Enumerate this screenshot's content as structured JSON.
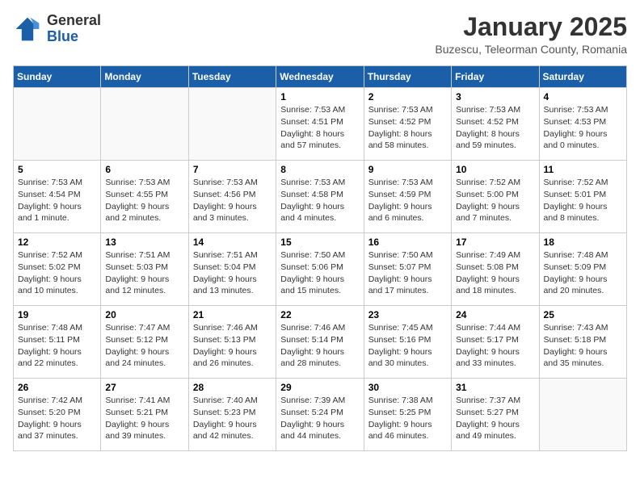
{
  "header": {
    "logo_line1": "General",
    "logo_line2": "Blue",
    "month": "January 2025",
    "location": "Buzescu, Teleorman County, Romania"
  },
  "weekdays": [
    "Sunday",
    "Monday",
    "Tuesday",
    "Wednesday",
    "Thursday",
    "Friday",
    "Saturday"
  ],
  "weeks": [
    [
      {
        "day": "",
        "info": ""
      },
      {
        "day": "",
        "info": ""
      },
      {
        "day": "",
        "info": ""
      },
      {
        "day": "1",
        "info": "Sunrise: 7:53 AM\nSunset: 4:51 PM\nDaylight: 8 hours and 57 minutes."
      },
      {
        "day": "2",
        "info": "Sunrise: 7:53 AM\nSunset: 4:52 PM\nDaylight: 8 hours and 58 minutes."
      },
      {
        "day": "3",
        "info": "Sunrise: 7:53 AM\nSunset: 4:52 PM\nDaylight: 8 hours and 59 minutes."
      },
      {
        "day": "4",
        "info": "Sunrise: 7:53 AM\nSunset: 4:53 PM\nDaylight: 9 hours and 0 minutes."
      }
    ],
    [
      {
        "day": "5",
        "info": "Sunrise: 7:53 AM\nSunset: 4:54 PM\nDaylight: 9 hours and 1 minute."
      },
      {
        "day": "6",
        "info": "Sunrise: 7:53 AM\nSunset: 4:55 PM\nDaylight: 9 hours and 2 minutes."
      },
      {
        "day": "7",
        "info": "Sunrise: 7:53 AM\nSunset: 4:56 PM\nDaylight: 9 hours and 3 minutes."
      },
      {
        "day": "8",
        "info": "Sunrise: 7:53 AM\nSunset: 4:58 PM\nDaylight: 9 hours and 4 minutes."
      },
      {
        "day": "9",
        "info": "Sunrise: 7:53 AM\nSunset: 4:59 PM\nDaylight: 9 hours and 6 minutes."
      },
      {
        "day": "10",
        "info": "Sunrise: 7:52 AM\nSunset: 5:00 PM\nDaylight: 9 hours and 7 minutes."
      },
      {
        "day": "11",
        "info": "Sunrise: 7:52 AM\nSunset: 5:01 PM\nDaylight: 9 hours and 8 minutes."
      }
    ],
    [
      {
        "day": "12",
        "info": "Sunrise: 7:52 AM\nSunset: 5:02 PM\nDaylight: 9 hours and 10 minutes."
      },
      {
        "day": "13",
        "info": "Sunrise: 7:51 AM\nSunset: 5:03 PM\nDaylight: 9 hours and 12 minutes."
      },
      {
        "day": "14",
        "info": "Sunrise: 7:51 AM\nSunset: 5:04 PM\nDaylight: 9 hours and 13 minutes."
      },
      {
        "day": "15",
        "info": "Sunrise: 7:50 AM\nSunset: 5:06 PM\nDaylight: 9 hours and 15 minutes."
      },
      {
        "day": "16",
        "info": "Sunrise: 7:50 AM\nSunset: 5:07 PM\nDaylight: 9 hours and 17 minutes."
      },
      {
        "day": "17",
        "info": "Sunrise: 7:49 AM\nSunset: 5:08 PM\nDaylight: 9 hours and 18 minutes."
      },
      {
        "day": "18",
        "info": "Sunrise: 7:48 AM\nSunset: 5:09 PM\nDaylight: 9 hours and 20 minutes."
      }
    ],
    [
      {
        "day": "19",
        "info": "Sunrise: 7:48 AM\nSunset: 5:11 PM\nDaylight: 9 hours and 22 minutes."
      },
      {
        "day": "20",
        "info": "Sunrise: 7:47 AM\nSunset: 5:12 PM\nDaylight: 9 hours and 24 minutes."
      },
      {
        "day": "21",
        "info": "Sunrise: 7:46 AM\nSunset: 5:13 PM\nDaylight: 9 hours and 26 minutes."
      },
      {
        "day": "22",
        "info": "Sunrise: 7:46 AM\nSunset: 5:14 PM\nDaylight: 9 hours and 28 minutes."
      },
      {
        "day": "23",
        "info": "Sunrise: 7:45 AM\nSunset: 5:16 PM\nDaylight: 9 hours and 30 minutes."
      },
      {
        "day": "24",
        "info": "Sunrise: 7:44 AM\nSunset: 5:17 PM\nDaylight: 9 hours and 33 minutes."
      },
      {
        "day": "25",
        "info": "Sunrise: 7:43 AM\nSunset: 5:18 PM\nDaylight: 9 hours and 35 minutes."
      }
    ],
    [
      {
        "day": "26",
        "info": "Sunrise: 7:42 AM\nSunset: 5:20 PM\nDaylight: 9 hours and 37 minutes."
      },
      {
        "day": "27",
        "info": "Sunrise: 7:41 AM\nSunset: 5:21 PM\nDaylight: 9 hours and 39 minutes."
      },
      {
        "day": "28",
        "info": "Sunrise: 7:40 AM\nSunset: 5:23 PM\nDaylight: 9 hours and 42 minutes."
      },
      {
        "day": "29",
        "info": "Sunrise: 7:39 AM\nSunset: 5:24 PM\nDaylight: 9 hours and 44 minutes."
      },
      {
        "day": "30",
        "info": "Sunrise: 7:38 AM\nSunset: 5:25 PM\nDaylight: 9 hours and 46 minutes."
      },
      {
        "day": "31",
        "info": "Sunrise: 7:37 AM\nSunset: 5:27 PM\nDaylight: 9 hours and 49 minutes."
      },
      {
        "day": "",
        "info": ""
      }
    ]
  ]
}
